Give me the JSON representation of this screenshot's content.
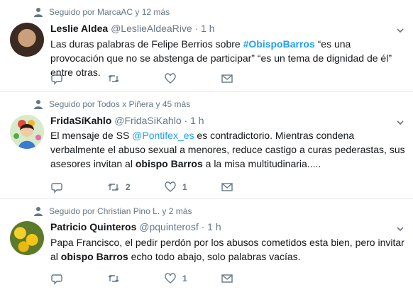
{
  "tweets": [
    {
      "context": "Seguido por MarcaAC y 12 más",
      "name": "Leslie Aldea",
      "handle": "@LeslieAldeaRive",
      "time": "· 1 h",
      "text": {
        "p1": "Las duras palabras de Felipe Berrios sobre ",
        "hashtag": "#ObispoBarros",
        "p2": " “es una provocación que no se abstenga de participar” “es un tema de dignidad de él” entre otras."
      },
      "counts": {
        "reply": "",
        "retweet": "",
        "like": ""
      }
    },
    {
      "context": "Seguido por Todos x Piñera y 45 más",
      "name": "FridaSíKahlo",
      "handle": "@FridaSiKahlo",
      "time": "· 1 h",
      "text": {
        "p1": "El mensaje de SS ",
        "mention": "@Pontifex_es",
        "p2": " es contradictorio. Mientras condena verbalmente el abuso sexual a menores, reduce castigo a curas pederastas, sus asesores invitan al ",
        "keyword": "obispo Barros",
        "p3": " a la misa multitudinaria....."
      },
      "counts": {
        "reply": "",
        "retweet": "2",
        "like": "1"
      }
    },
    {
      "context": "Seguido por Christian Pino L. y 2 más",
      "name": "Patricio Quinteros",
      "handle": "@pquinterosf",
      "time": "· 1 h",
      "text": {
        "p1": "Papa Francisco, el pedir perdón por los abusos cometidos esta bien, pero invitar al ",
        "keyword": "obispo Barros",
        "p2": " echo todo abajo, solo palabras vacías."
      },
      "counts": {
        "reply": "",
        "retweet": "",
        "like": "1"
      }
    }
  ],
  "colors": {
    "accent": "#1da1f2",
    "muted": "#657786",
    "border": "#e6ecf0"
  },
  "icons": [
    "person-icon",
    "caret-down-icon",
    "reply-icon",
    "retweet-icon",
    "like-icon",
    "message-icon"
  ]
}
